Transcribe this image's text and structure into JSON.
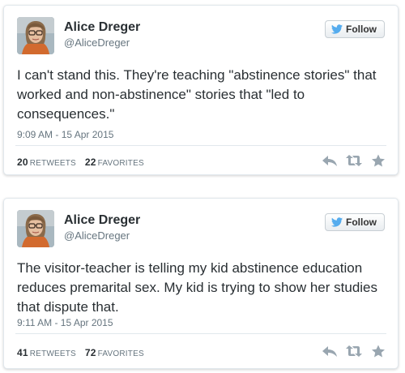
{
  "colors": {
    "text": "#292f33",
    "muted": "#66757f",
    "twitter_blue": "#55acee",
    "icon_gray": "#99a6b0"
  },
  "tweets": [
    {
      "name": "Alice Dreger",
      "handle": "@AliceDreger",
      "follow_label": "Follow",
      "text": "I can't stand this. They're teaching \"abstinence stories\" that worked and non-abstinence\" stories that \"led to consequences.\"",
      "timestamp": "9:09 AM - 15 Apr 2015",
      "retweets": "20",
      "retweets_label": "RETWEETS",
      "favorites": "22",
      "favorites_label": "FAVORITES",
      "icons": [
        "reply-icon",
        "retweet-icon",
        "favorite-icon"
      ]
    },
    {
      "name": "Alice Dreger",
      "handle": "@AliceDreger",
      "follow_label": "Follow",
      "text": "The visitor-teacher is telling my kid abstinence education reduces premarital sex. My kid is trying to show her studies that dispute that.",
      "timestamp": "9:11 AM - 15 Apr 2015",
      "retweets": "41",
      "retweets_label": "RETWEETS",
      "favorites": "72",
      "favorites_label": "FAVORITES",
      "icons": [
        "reply-icon",
        "retweet-icon",
        "favorite-icon"
      ]
    }
  ]
}
